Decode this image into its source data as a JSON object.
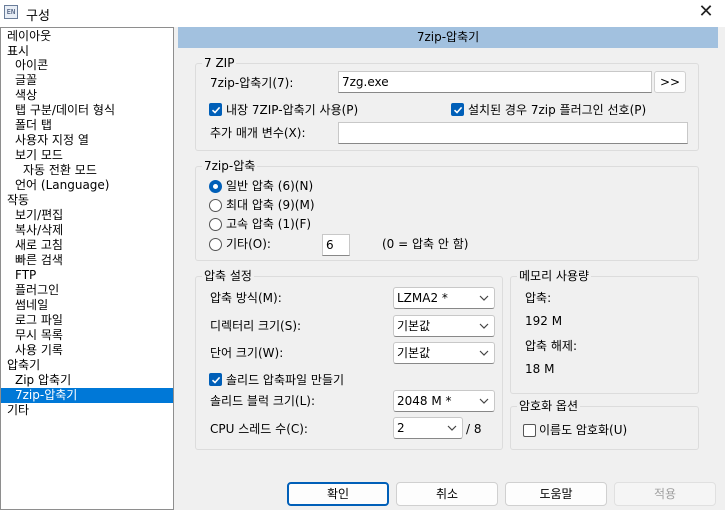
{
  "window": {
    "title": "구성",
    "icon_text": "EN",
    "close_glyph": "✕"
  },
  "tree": {
    "items": [
      {
        "label": "레이아웃"
      },
      {
        "label": "표시"
      },
      {
        "label": "아이콘"
      },
      {
        "label": "글꼴"
      },
      {
        "label": "색상"
      },
      {
        "label": "탭 구분/데이터 형식"
      },
      {
        "label": "폴더 탭"
      },
      {
        "label": "사용자 지정 열"
      },
      {
        "label": "보기 모드"
      },
      {
        "label": "자동 전환 모드"
      },
      {
        "label": "언어 (Language)"
      },
      {
        "label": "작동"
      },
      {
        "label": "보기/편집"
      },
      {
        "label": "복사/삭제"
      },
      {
        "label": "새로 고침"
      },
      {
        "label": "빠른 검색"
      },
      {
        "label": "FTP"
      },
      {
        "label": "플러그인"
      },
      {
        "label": "썸네일"
      },
      {
        "label": "로그 파일"
      },
      {
        "label": "무시 목록"
      },
      {
        "label": "사용 기록"
      },
      {
        "label": "압축기"
      },
      {
        "label": "Zip 압축기"
      },
      {
        "label": "7zip-압축기"
      },
      {
        "label": "기타"
      }
    ]
  },
  "header": {
    "title": "7zip-압축기"
  },
  "group7zip": {
    "title": "7 ZIP",
    "path_label": "7zip-압축기(7):",
    "path_value": "7zg.exe",
    "browse_label": ">>",
    "builtin_label": "내장 7ZIP-압축기 사용(P)",
    "builtin_checked": true,
    "prefer_plugin_label": "설치된 경우 7zip 플러그인 선호(P)",
    "prefer_plugin_checked": true,
    "extra_args_label": "추가 매개 변수(X):",
    "extra_args_value": ""
  },
  "compress": {
    "title": "7zip-압축",
    "options": [
      {
        "label": "일반 압축 (6)(N)",
        "checked": true
      },
      {
        "label": "최대 압축 (9)(M)",
        "checked": false
      },
      {
        "label": "고속 압축 (1)(F)",
        "checked": false
      },
      {
        "label": "기타(O):",
        "checked": false
      }
    ],
    "other_value": "6",
    "other_hint": "(0 = 압축 안 함)"
  },
  "settings": {
    "title": "압축 설정",
    "method_label": "압축 방식(M):",
    "method_value": "LZMA2 *",
    "dict_label": "디렉터리 크기(S):",
    "dict_value": "기본값",
    "word_label": "단어 크기(W):",
    "word_value": "기본값",
    "solid_label": "솔리드 압축파일 만들기",
    "solid_checked": true,
    "block_label": "솔리드 블럭 크기(L):",
    "block_value": "2048 M *",
    "threads_label": "CPU 스레드 수(C):",
    "threads_value": "2",
    "threads_max": "/ 8"
  },
  "memory": {
    "title": "메모리 사용량",
    "compress_label": "압축:",
    "compress_value": "192 M",
    "decompress_label": "압축 해제:",
    "decompress_value": "18 M"
  },
  "encryption": {
    "title": "암호화 옵션",
    "names_label": "이름도 암호화(U)",
    "names_checked": false
  },
  "buttons": {
    "ok": "확인",
    "cancel": "취소",
    "help": "도움말",
    "apply": "적용"
  },
  "colors": {
    "accent": "#005fb8",
    "selection": "#0078d7",
    "header_bg": "#a2c1df"
  }
}
